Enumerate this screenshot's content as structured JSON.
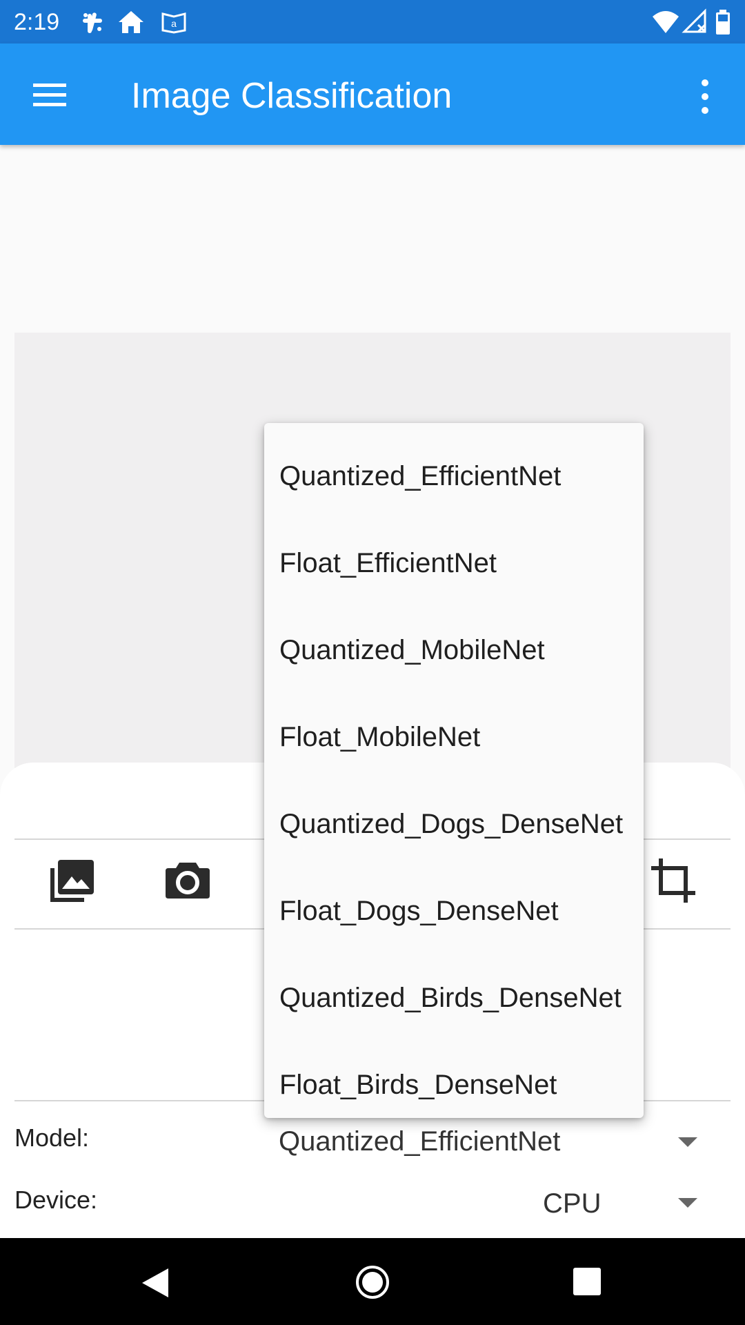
{
  "status_bar": {
    "time": "2:19",
    "icons": [
      "slack-icon",
      "home-icon",
      "amazon-kindle-icon",
      "wifi-icon",
      "cellular-no-signal-icon",
      "battery-icon"
    ]
  },
  "app_bar": {
    "title": "Image Classification",
    "menu_icon": "hamburger-menu-icon",
    "overflow_icon": "more-vert-icon"
  },
  "toolbar": {
    "icons": [
      "gallery-icon",
      "camera-icon",
      "crop-icon"
    ]
  },
  "settings": {
    "model_label": "Model:",
    "model_value": "Quantized_EfficientNet",
    "device_label": "Device:",
    "device_value": "CPU"
  },
  "model_dropdown": {
    "options": [
      "Quantized_EfficientNet",
      "Float_EfficientNet",
      "Quantized_MobileNet",
      "Float_MobileNet",
      "Quantized_Dogs_DenseNet",
      "Float_Dogs_DenseNet",
      "Quantized_Birds_DenseNet",
      "Float_Birds_DenseNet"
    ]
  },
  "nav_bar": {
    "icons": [
      "back-icon",
      "home-icon",
      "recents-icon"
    ]
  },
  "colors": {
    "status_bar": "#1a76d2",
    "app_bar": "#2196f3"
  }
}
